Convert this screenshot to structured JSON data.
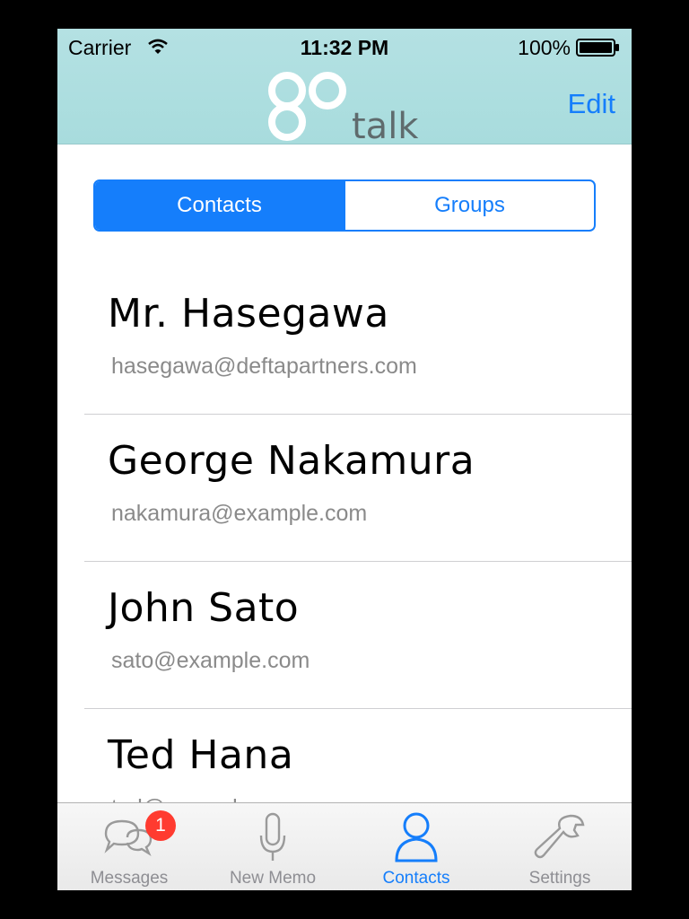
{
  "status_bar": {
    "carrier": "Carrier",
    "time": "11:32 PM",
    "battery": "100%"
  },
  "header": {
    "logo_go": "go",
    "logo_talk": "talk",
    "edit_label": "Edit"
  },
  "segments": [
    {
      "label": "Contacts",
      "selected": true
    },
    {
      "label": "Groups",
      "selected": false
    }
  ],
  "contacts": [
    {
      "name": "Mr. Hasegawa",
      "email": "hasegawa@deftapartners.com"
    },
    {
      "name": "George Nakamura",
      "email": "nakamura@example.com"
    },
    {
      "name": "John Sato",
      "email": "sato@example.com"
    },
    {
      "name": "Ted Hana",
      "email": "ted@example.com"
    }
  ],
  "tab_bar": {
    "tabs": [
      {
        "label": "Messages",
        "icon": "speech-bubbles-icon",
        "badge": "1"
      },
      {
        "label": "New Memo",
        "icon": "microphone-icon"
      },
      {
        "label": "Contacts",
        "icon": "person-icon",
        "active": true
      },
      {
        "label": "Settings",
        "icon": "wrench-icon"
      }
    ]
  },
  "colors": {
    "accent": "#157efb",
    "header_bg": "#b0dfe1",
    "badge": "#ff3b30",
    "secondary_text": "#8a8a8a"
  }
}
